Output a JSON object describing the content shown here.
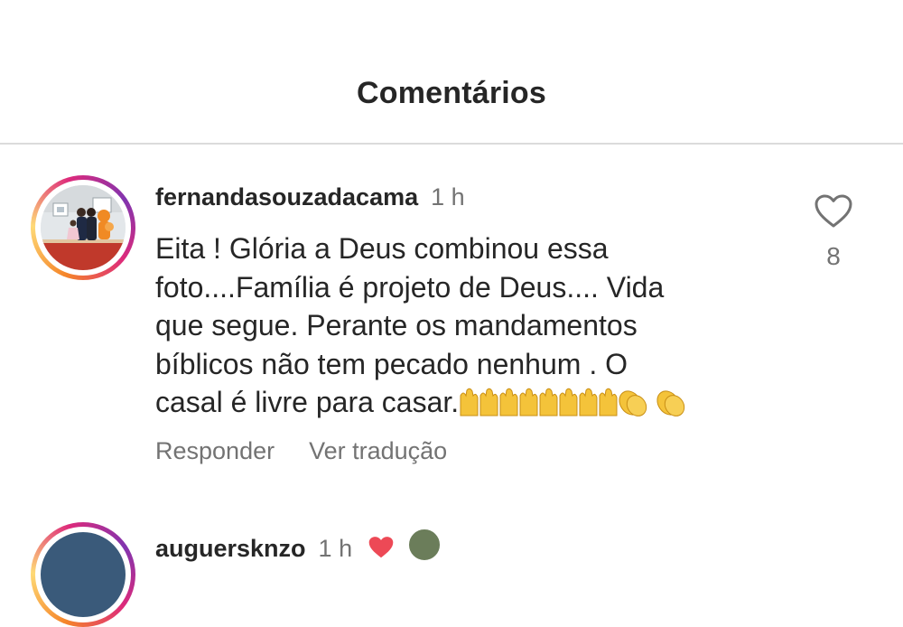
{
  "header": {
    "title": "Comentários"
  },
  "comments": [
    {
      "username": "fernandasouzadacama",
      "time": "1 h",
      "text_lines": [
        "Eita ! Glória a Deus combinou essa",
        "foto....Família  é projeto  de Deus.... Vida",
        "que segue. Perante os mandamentos",
        "bíblicos não  tem pecado  nenhum . O",
        "casal é livre para casar."
      ],
      "emojis": "raised-hands x8, clapping-hands x2",
      "like_icon": "heart-outline-icon",
      "like_count": "8",
      "reply_label": "Responder",
      "translate_label": "Ver tradução"
    },
    {
      "username": "auguersknzo",
      "time": "1 h",
      "badge_icon": "red-heart-icon"
    }
  ],
  "colors": {
    "text_primary": "#262626",
    "text_secondary": "#737373",
    "divider": "#dbdbdb",
    "emoji_yellow": "#f4c33a",
    "heart_red": "#ed4956"
  }
}
